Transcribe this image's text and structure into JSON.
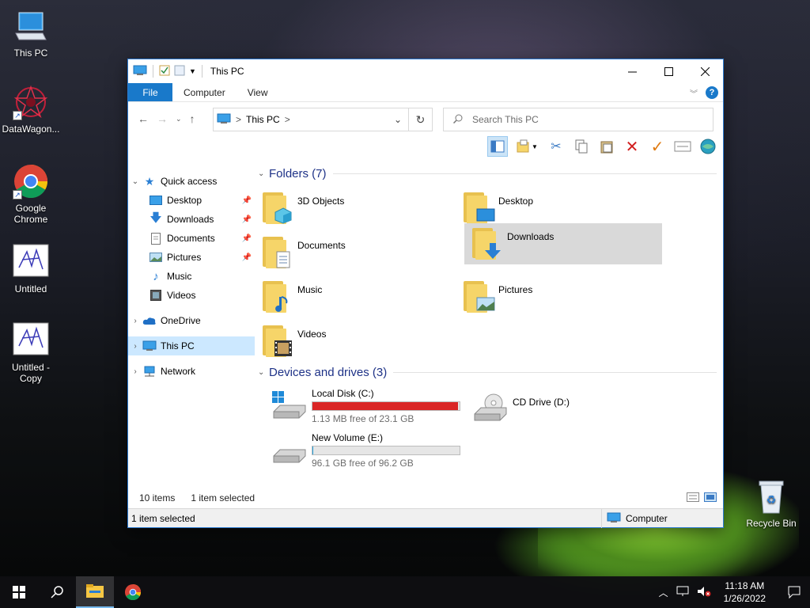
{
  "desktop": {
    "icons": [
      {
        "label": "This PC"
      },
      {
        "label": "DataWagon..."
      },
      {
        "label": "Google Chrome"
      },
      {
        "label": "Untitled"
      },
      {
        "label": "Untitled - Copy"
      },
      {
        "label": "Recycle Bin"
      }
    ]
  },
  "window": {
    "title": "This PC",
    "ribbon": {
      "file_label": "File",
      "tabs": [
        "Computer",
        "View"
      ],
      "help": "?"
    },
    "address": {
      "location": "This PC",
      "separator": ">"
    },
    "search": {
      "placeholder": "Search This PC"
    },
    "sidebar": {
      "quick_access": "Quick access",
      "items": [
        {
          "label": "Desktop",
          "pinned": true
        },
        {
          "label": "Downloads",
          "pinned": true
        },
        {
          "label": "Documents",
          "pinned": true
        },
        {
          "label": "Pictures",
          "pinned": true
        },
        {
          "label": "Music",
          "pinned": false
        },
        {
          "label": "Videos",
          "pinned": false
        }
      ],
      "onedrive": "OneDrive",
      "this_pc": "This PC",
      "network": "Network"
    },
    "folders": {
      "heading": "Folders (7)",
      "items": [
        {
          "label": "3D Objects"
        },
        {
          "label": "Desktop"
        },
        {
          "label": "Documents"
        },
        {
          "label": "Downloads",
          "selected": true
        },
        {
          "label": "Music"
        },
        {
          "label": "Pictures"
        },
        {
          "label": "Videos"
        }
      ]
    },
    "drives": {
      "heading": "Devices and drives (3)",
      "items": [
        {
          "label": "Local Disk (C:)",
          "free": "1.13 MB free of 23.1 GB",
          "used_fraction": 0.99
        },
        {
          "label": "CD Drive (D:)"
        },
        {
          "label": "New Volume (E:)",
          "free": "96.1 GB free of 96.2 GB",
          "used_fraction": 0.001
        }
      ]
    },
    "status": {
      "items": "10 items",
      "selected": "1 item selected",
      "bottom_selected": "1 item selected",
      "bottom_right": "Computer"
    }
  },
  "taskbar": {
    "time": "11:18 AM",
    "date": "1/26/2022"
  },
  "colors": {
    "accent": "#1979ca",
    "drive_full": "#da2626",
    "folder": "#f6d569"
  }
}
